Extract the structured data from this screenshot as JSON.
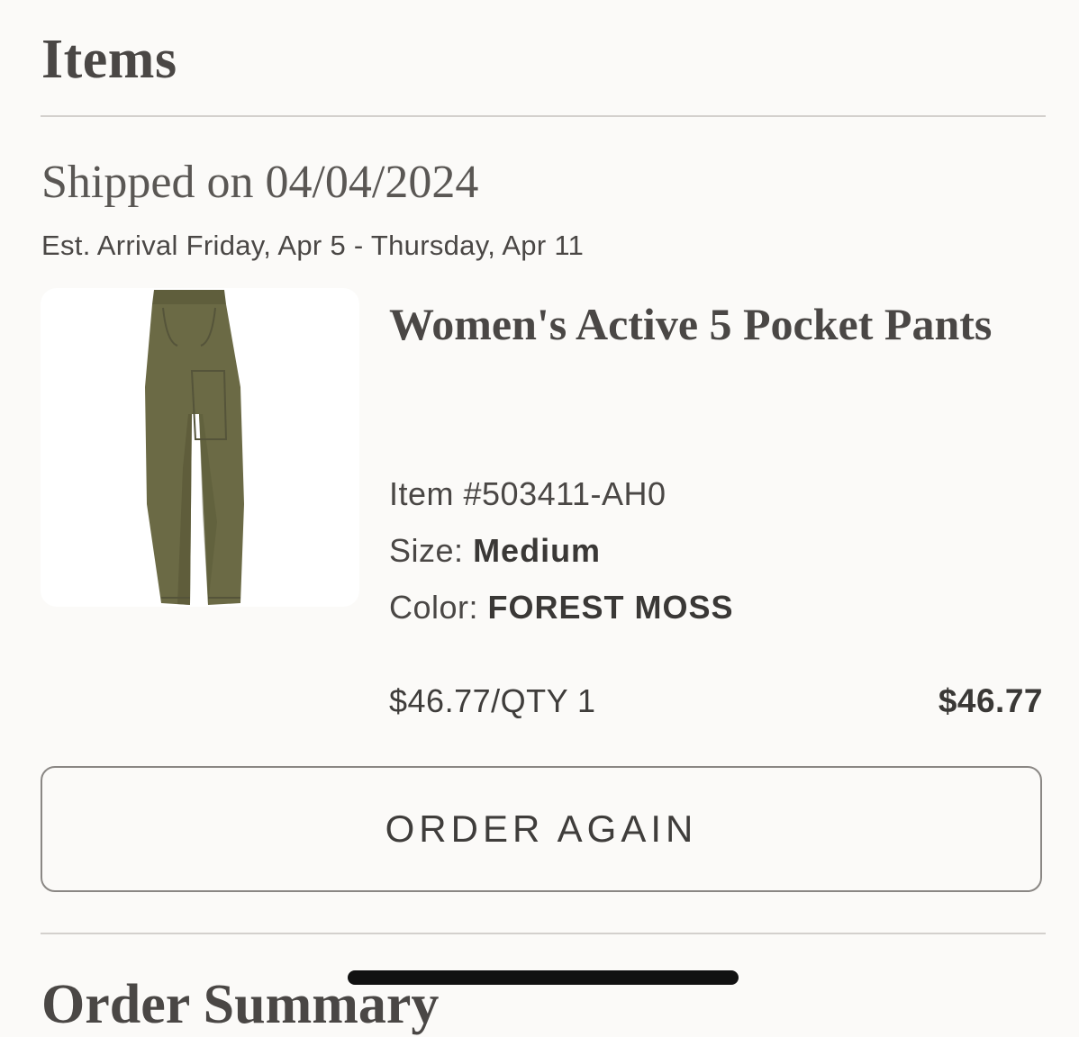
{
  "items_heading": "Items",
  "shipment": {
    "shipped_on": "Shipped on 04/04/2024",
    "est_arrival": "Est. Arrival Friday, Apr 5 - Thursday, Apr 11"
  },
  "product": {
    "image_icon": "pants-image",
    "image_color": "#6b6a45",
    "title": "Women's Active 5 Pocket Pants",
    "item_label": "Item #503411-AH0",
    "size_label": "Size:",
    "size_value": "Medium",
    "color_label": "Color:",
    "color_value": "FOREST MOSS",
    "unit_price_qty": "$46.77/QTY 1",
    "line_total": "$46.77"
  },
  "actions": {
    "order_again_label": "ORDER AGAIN"
  },
  "next_section_heading": "Order Summary"
}
